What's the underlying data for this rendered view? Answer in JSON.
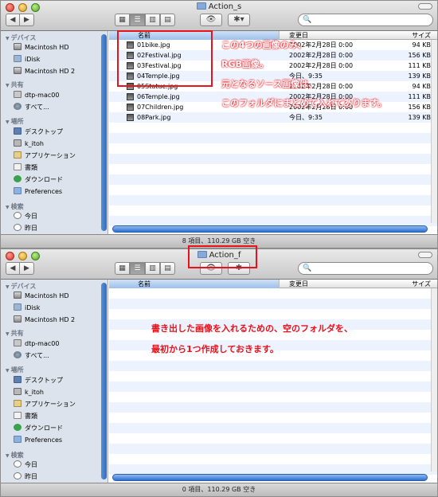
{
  "window1": {
    "title": "Action_s",
    "back_label": "◀",
    "forward_label": "▶",
    "eye_label": "👁",
    "gear_label": "✱▾",
    "search_icon": "🔍",
    "sidebar": {
      "devices_header": "デバイス",
      "devices": [
        "Macintosh HD",
        "iDisk",
        "Macintosh HD 2"
      ],
      "shared_header": "共有",
      "shared": [
        "dtp-mac00",
        "すべて..."
      ],
      "places_header": "場所",
      "places": [
        "デスクトップ",
        "k_itoh",
        "アプリケーション",
        "書類",
        "ダウンロード",
        "Preferences"
      ],
      "search_header": "検索",
      "search_items": [
        "今日",
        "昨日"
      ]
    },
    "columns": {
      "name": "名前",
      "date": "変更日",
      "size": "サイズ"
    },
    "files": [
      {
        "name": "01bike.jpg",
        "date": "2002年2月28日 0:00",
        "size": "94 KB"
      },
      {
        "name": "02Festival.jpg",
        "date": "2002年2月28日 0:00",
        "size": "156 KB"
      },
      {
        "name": "03Festival.jpg",
        "date": "2002年2月28日 0:00",
        "size": "111 KB"
      },
      {
        "name": "04Temple.jpg",
        "date": "今日、9:35",
        "size": "139 KB"
      },
      {
        "name": "05Statue.jpg",
        "date": "2002年2月28日 0:00",
        "size": "94 KB"
      },
      {
        "name": "06Temple.jpg",
        "date": "2002年2月28日 0:00",
        "size": "111 KB"
      },
      {
        "name": "07Children.jpg",
        "date": "2002年2月28日 0:00",
        "size": "156 KB"
      },
      {
        "name": "08Park.jpg",
        "date": "今日、9:35",
        "size": "139 KB"
      }
    ],
    "status": "8 項目、110.29 GB 空き"
  },
  "window2": {
    "title": "Action_f",
    "back_label": "◀",
    "forward_label": "▶",
    "eye_label": "👁",
    "gear_label": "✱",
    "search_icon": "🔍",
    "sidebar": {
      "devices_header": "デバイス",
      "devices": [
        "Macintosh HD",
        "iDisk",
        "Macintosh HD 2"
      ],
      "shared_header": "共有",
      "shared": [
        "dtp-mac00",
        "すべて..."
      ],
      "places_header": "場所",
      "places": [
        "デスクトップ",
        "k_itoh",
        "アプリケーション",
        "書類",
        "ダウンロード",
        "Preferences"
      ],
      "search_header": "検索",
      "search_items": [
        "今日",
        "昨日"
      ]
    },
    "columns": {
      "name": "名前",
      "date": "変更日",
      "size": "サイズ"
    },
    "status": "0 項目、110.29 GB 空き"
  },
  "annotations": {
    "line1": "この4つの画像のみ、",
    "line2": "RGB画像。",
    "line3": "元となるソース画像は、",
    "line4": "このフォルダにまとめて入れてあります。",
    "line5": "書き出した画像を入れるための、空のフォルダを、",
    "line6": "最初から1つ作成しておきます。"
  },
  "colors": {
    "annotation_red": "#e8121b",
    "sidebar_bg": "#dce3ec",
    "row_stripe": "#edf3fe"
  }
}
